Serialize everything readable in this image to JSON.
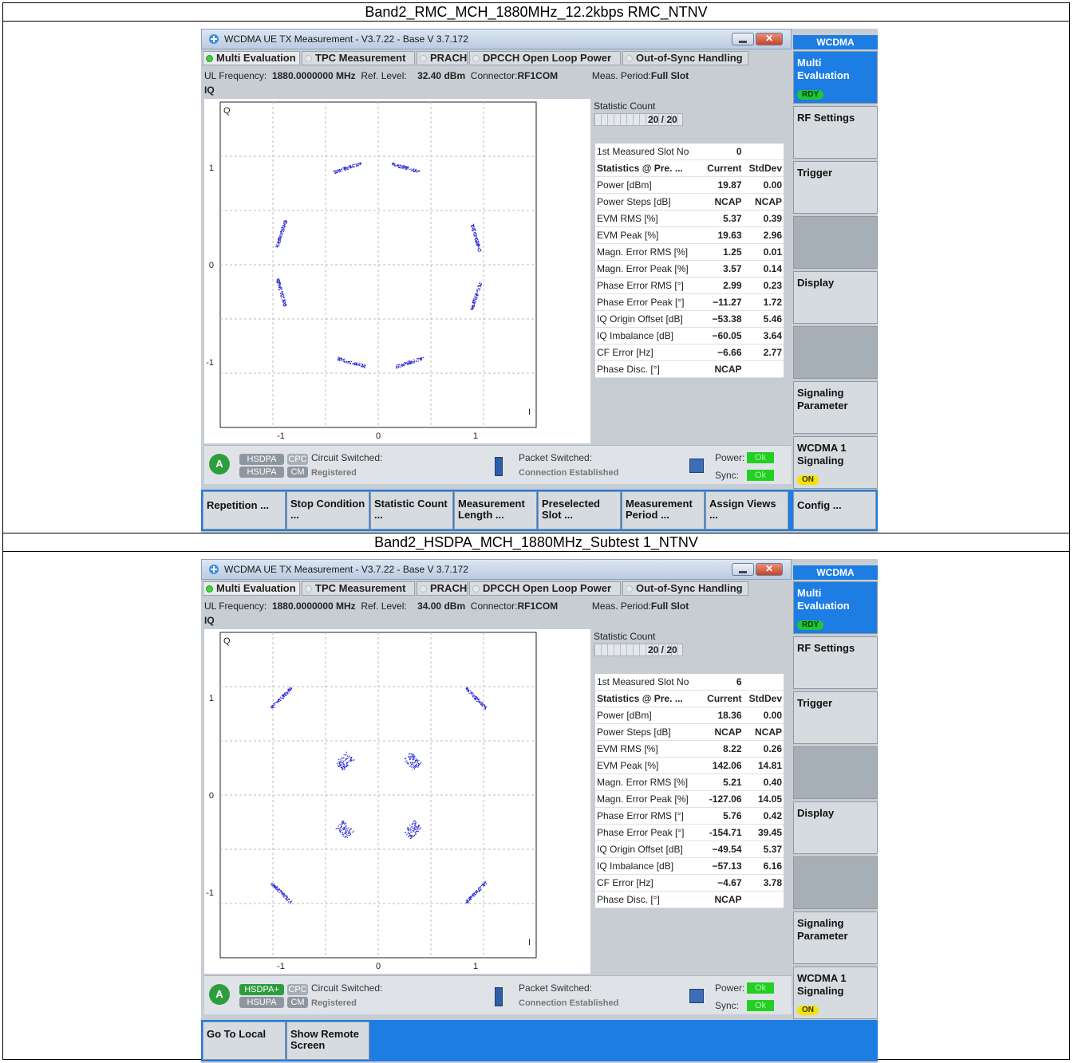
{
  "captions": [
    "Band2_RMC_MCH_1880MHz_12.2kbps RMC_NTNV",
    "Band2_HSDPA_MCH_1880MHz_Subtest 1_NTNV"
  ],
  "window": {
    "title": "WCDMA UE TX Measurement  - V3.7.22 - Base V 3.7.172"
  },
  "tabs": [
    "Multi Evaluation",
    "TPC Measurement",
    "PRACH",
    "DPCCH Open Loop Power",
    "Out-of-Sync Handling"
  ],
  "labels": {
    "ul_freq_label": "UL Frequency:",
    "ref_level_label": "Ref. Level:",
    "connector_label": "Connector:",
    "meas_period_label": "Meas. Period:",
    "iq": "IQ",
    "stat_count": "Statistic Count",
    "circuit_switched": "Circuit Switched:",
    "registered": "Registered",
    "packet_switched": "Packet Switched:",
    "connection": "Connection Established",
    "power": "Power:",
    "sync": "Sync:",
    "ok": "Ok",
    "q_axis": "Q",
    "i_axis": "I",
    "badge_cpc": "CPC",
    "badge_cm": "CM",
    "badge_hsupa": "HSUPA"
  },
  "plot_ticks": {
    "x": [
      "-1",
      "0",
      "1"
    ],
    "y": [
      "1",
      "0",
      "-1"
    ]
  },
  "sidebar": {
    "header": "WCDMA",
    "items": [
      {
        "label": "Multi Evaluation",
        "badge": "RDY"
      },
      {
        "label": "RF Settings"
      },
      {
        "label": "Trigger"
      },
      {
        "label": ""
      },
      {
        "label": "Display"
      },
      {
        "label": ""
      },
      {
        "label": "Signaling Parameter"
      },
      {
        "label": "WCDMA 1 Signaling",
        "badge": "ON"
      }
    ]
  },
  "softkeys_1": [
    "Repetition ...",
    "Stop Condition ...",
    "Statistic Count ...",
    "Measurement Length ...",
    "Preselected Slot ...",
    "Measurement Period ...",
    "Assign Views ...",
    "Config ..."
  ],
  "softkeys_2": [
    "Go To Local",
    "Show Remote Screen"
  ],
  "screens": [
    {
      "ul_freq": "1880.0000000 MHz",
      "ref_level": "32.40 dBm",
      "connector": "RF1COM",
      "meas_period": "Full Slot",
      "stat_count": "20 / 20",
      "hsdpa_badge": "HSDPA",
      "slot_label": "1st Measured Slot No",
      "slot_value": "0",
      "stats_header": [
        "Statistics @ Pre. ...",
        "Current",
        "StdDev"
      ],
      "stats": [
        [
          "Power [dBm]",
          "19.87",
          "0.00"
        ],
        [
          "Power Steps [dB]",
          "NCAP",
          "NCAP"
        ],
        [
          "EVM RMS [%]",
          "5.37",
          "0.39"
        ],
        [
          "EVM Peak [%]",
          "19.63",
          "2.96"
        ],
        [
          "Magn. Error RMS [%]",
          "1.25",
          "0.01"
        ],
        [
          "Magn. Error Peak [%]",
          "3.57",
          "0.14"
        ],
        [
          "Phase Error RMS [°]",
          "2.99",
          "0.23"
        ],
        [
          "Phase Error Peak [°]",
          "−11.27",
          "1.72"
        ],
        [
          "IQ Origin Offset [dB]",
          "−53.38",
          "5.46"
        ],
        [
          "IQ Imbalance [dB]",
          "−60.05",
          "3.64"
        ],
        [
          "CF Error [Hz]",
          "−6.66",
          "2.77"
        ],
        [
          "Phase Disc. [°]",
          "NCAP",
          ""
        ]
      ],
      "clusters": [
        [
          -0.32,
          1.0
        ],
        [
          0.28,
          1.0
        ],
        [
          -1.0,
          0.32
        ],
        [
          1.0,
          0.28
        ],
        [
          -1.0,
          -0.28
        ],
        [
          1.0,
          -0.32
        ],
        [
          -0.28,
          -1.0
        ],
        [
          0.32,
          -1.0
        ]
      ]
    },
    {
      "ul_freq": "1880.0000000 MHz",
      "ref_level": "34.00 dBm",
      "connector": "RF1COM",
      "meas_period": "Full Slot",
      "stat_count": "20 / 20",
      "hsdpa_badge": "HSDPA+",
      "slot_label": "1st Measured Slot No",
      "slot_value": "6",
      "stats_header": [
        "Statistics @ Pre. ...",
        "Current",
        "StdDev"
      ],
      "stats": [
        [
          "Power [dBm]",
          "18.36",
          "0.00"
        ],
        [
          "Power Steps [dB]",
          "NCAP",
          "NCAP"
        ],
        [
          "EVM RMS [%]",
          "8.22",
          "0.26"
        ],
        [
          "EVM Peak [%]",
          "142.06",
          "14.81"
        ],
        [
          "Magn. Error RMS [%]",
          "5.21",
          "0.40"
        ],
        [
          "Magn. Error Peak [%]",
          "-127.06",
          "14.05"
        ],
        [
          "Phase Error RMS [°]",
          "5.76",
          "0.42"
        ],
        [
          "Phase Error Peak [°]",
          "-154.71",
          "39.45"
        ],
        [
          "IQ Origin Offset [dB]",
          "−49.54",
          "5.37"
        ],
        [
          "IQ Imbalance [dB]",
          "−57.13",
          "6.16"
        ],
        [
          "CF Error [Hz]",
          "−4.67",
          "3.78"
        ],
        [
          "Phase Disc. [°]",
          "NCAP",
          ""
        ]
      ],
      "clusters": [
        [
          -1.0,
          1.0
        ],
        [
          1.0,
          1.0
        ],
        [
          -0.35,
          0.35
        ],
        [
          0.35,
          0.35
        ],
        [
          -0.35,
          -0.35
        ],
        [
          0.35,
          -0.35
        ],
        [
          -1.0,
          -1.0
        ],
        [
          1.0,
          -1.0
        ]
      ]
    }
  ],
  "colors": {
    "accent": "#1d7de3",
    "ok": "#21d021",
    "scatter": "#2b2bd8"
  }
}
